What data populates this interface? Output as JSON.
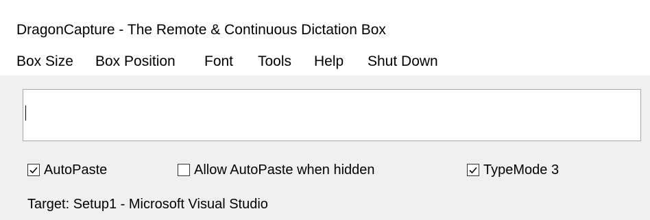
{
  "window": {
    "title": "DragonCapture - The Remote & Continuous Dictation Box"
  },
  "menu": {
    "items": [
      "Box Size",
      "Box Position",
      "Font",
      "Tools",
      "Help",
      "Shut Down"
    ]
  },
  "editor": {
    "value": ""
  },
  "options": {
    "autopaste": {
      "label": "AutoPaste",
      "checked": true
    },
    "allow_hidden": {
      "label": "Allow AutoPaste when hidden",
      "checked": false
    },
    "typemode": {
      "label": "TypeMode 3",
      "checked": true
    }
  },
  "status": {
    "target": "Target: Setup1 - Microsoft Visual Studio"
  }
}
